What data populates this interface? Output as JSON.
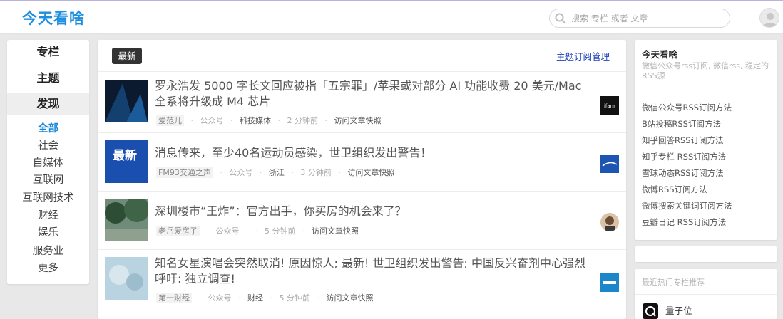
{
  "header": {
    "logo": "今天看啥",
    "search_placeholder": "搜索 专栏 或者 文章"
  },
  "left_nav": {
    "main_items": [
      "专栏",
      "主题",
      "发现"
    ],
    "active_main": "发现",
    "categories": [
      "全部",
      "社会",
      "自媒体",
      "互联网",
      "互联网技术",
      "财经",
      "娱乐",
      "服务业",
      "更多"
    ],
    "active_category": "全部"
  },
  "feed": {
    "tab_label": "最新",
    "manage_link": "主题订阅管理",
    "articles": [
      {
        "title": "罗永浩发 5000 字长文回应被指「五宗罪」/苹果或对部分 AI 功能收费 20 美元/Mac 全系将升级成 M4 芯片",
        "source": "爱范儿",
        "type": "公众号",
        "category": "科技媒体",
        "time": "2 分钟前",
        "snapshot": "访问文章快照",
        "favicon_text": "ifanr"
      },
      {
        "title": "消息传来，至少40名运动员感染，世卫组织发出警告！",
        "source": "FM93交通之声",
        "type": "公众号",
        "category": "浙江",
        "time": "3 分钟前",
        "snapshot": "访问文章快照",
        "thumb_text": "最新"
      },
      {
        "title": "深圳楼市“王炸”：官方出手，你买房的机会来了？",
        "source": "老岳爱房子",
        "type": "公众号",
        "category": "",
        "time": "5 分钟前",
        "snapshot": "访问文章快照"
      },
      {
        "title": "知名女星演唱会突然取消! 原因惊人; 最新! 世卫组织发出警告; 中国反兴奋剂中心强烈呼吁: 独立调查!",
        "source": "第一财经",
        "type": "公众号",
        "category": "财经",
        "time": "5 分钟前",
        "snapshot": "访问文章快照"
      }
    ]
  },
  "right_panel": {
    "title": "今天看啥",
    "description": "微信公众号rss订阅, 微信rss, 稳定的RSS源",
    "links": [
      "微信公众号RSS订阅方法",
      "B站投稿RSS订阅方法",
      "知乎回答RSS订阅方法",
      "知乎专栏 RSS订阅方法",
      "雪球动态RSS订阅方法",
      "微博RSS订阅方法",
      "微博搜索关键词订阅方法",
      "豆瓣日记 RSS订阅方法"
    ],
    "recommend_title": "最近热门专栏推荐",
    "recommend_item": "量子位"
  },
  "colors": {
    "accent": "#1a86d8",
    "link_blue": "#1a3fb8",
    "page_bg": "#e8e8e8"
  }
}
